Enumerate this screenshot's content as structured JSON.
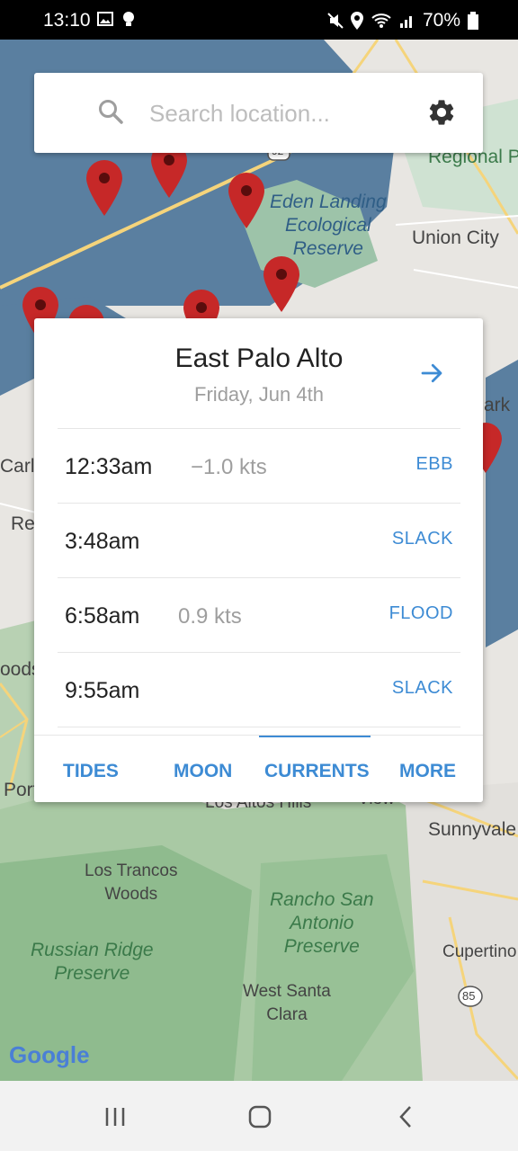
{
  "status_bar": {
    "time": "13:10",
    "battery": "70%"
  },
  "search": {
    "placeholder": "Search location..."
  },
  "map_labels": {
    "eden_landing": "Eden Landing\nEcological\nReserve",
    "union_city": "Union City",
    "regional": "arin\nRegional P",
    "carlo": "Carlo",
    "re": "Re",
    "oods": "oods",
    "ark": "ark",
    "port": "Port",
    "los_altos_hills": "Los Altos Hills",
    "view": "View",
    "sunnyvale": "Sunnyvale",
    "los_trancos": "Los Trancos\nWoods",
    "rancho": "Rancho San\nAntonio\nPreserve",
    "russian_ridge": "Russian Ridge\nPreserve",
    "cupertino": "Cupertino",
    "west_santa_clara": "West Santa\nClara",
    "hwy_92": "92",
    "hwy_85": "85",
    "google": "Google"
  },
  "panel": {
    "title": "East Palo Alto",
    "date": "Friday, Jun 4th",
    "rows": [
      {
        "time": "12:33am",
        "speed": "−1.0 kts",
        "kind": "EBB"
      },
      {
        "time": "3:48am",
        "speed": "",
        "kind": "SLACK"
      },
      {
        "time": "6:58am",
        "speed": "0.9 kts",
        "kind": "FLOOD"
      },
      {
        "time": "9:55am",
        "speed": "",
        "kind": "SLACK"
      }
    ],
    "tabs": [
      "TIDES",
      "MOON",
      "CURRENTS",
      "MORE"
    ],
    "active_tab": "CURRENTS"
  },
  "colors": {
    "accent": "#3d8bd4",
    "marker": "#c62828",
    "water": "#5a7fa0"
  },
  "icons": {
    "search": "search-icon",
    "settings": "gear-icon",
    "forward": "arrow-right-icon"
  }
}
